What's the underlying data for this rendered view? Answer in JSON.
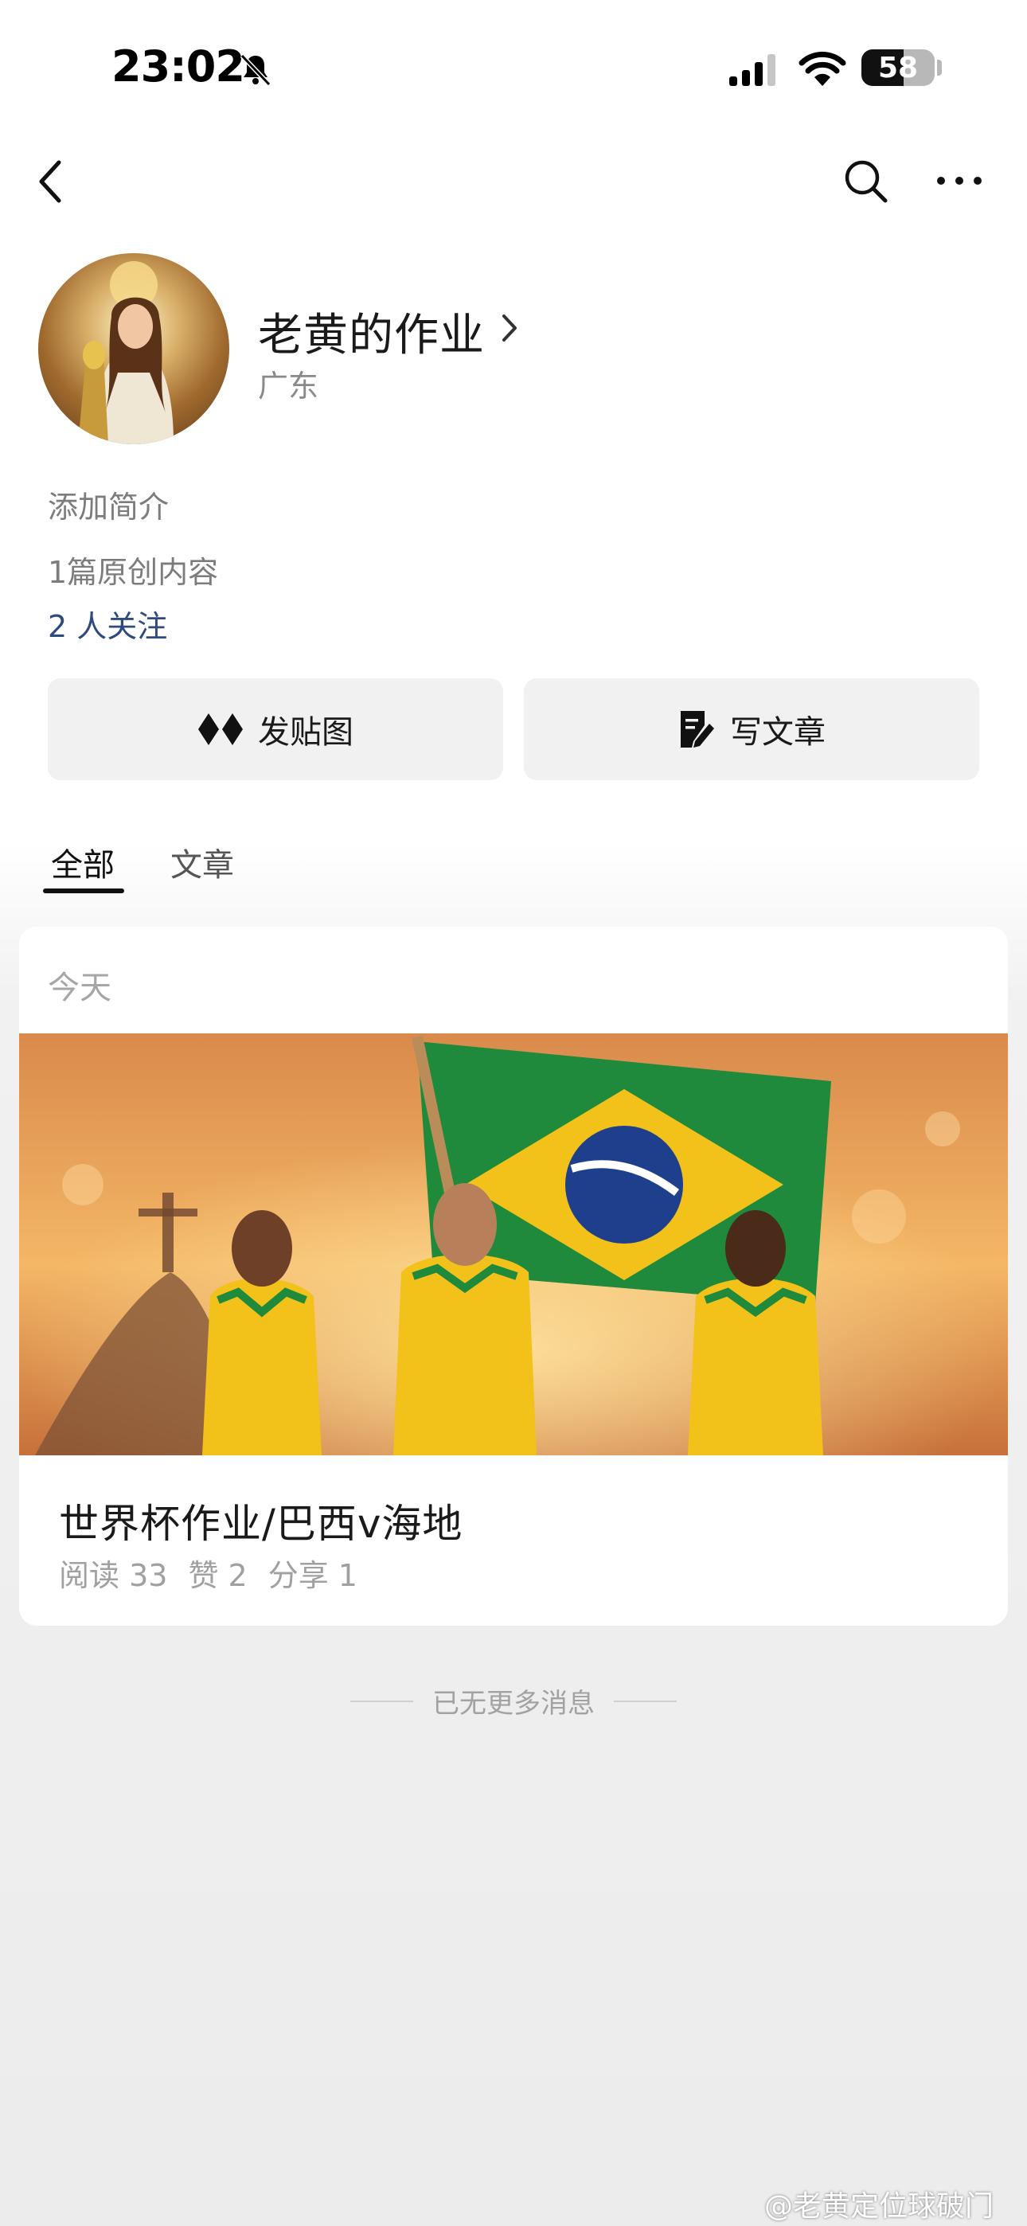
{
  "status_bar": {
    "time": "23:02",
    "battery": "58"
  },
  "profile": {
    "name": "老黄的作业",
    "region": "广东",
    "bio": "添加简介",
    "original_count": "1篇原创内容",
    "followers": "2 人关注"
  },
  "actions": {
    "post_image": "发贴图",
    "write_article": "写文章"
  },
  "tabs": [
    {
      "label": "全部"
    },
    {
      "label": "文章"
    }
  ],
  "feed": {
    "date": "今天",
    "post": {
      "title": "世界杯作业/巴西v海地",
      "reads": "阅读 33",
      "likes": "赞 2",
      "shares": "分享 1",
      "image_icon": "team-photo"
    }
  },
  "footer": {
    "end_text": "已无更多消息",
    "watermark": "@老黄定位球破门"
  },
  "colors": {
    "link": "#2f4a7d",
    "brazil_yellow": "#f2c21b",
    "brazil_green": "#1f8a3b"
  }
}
